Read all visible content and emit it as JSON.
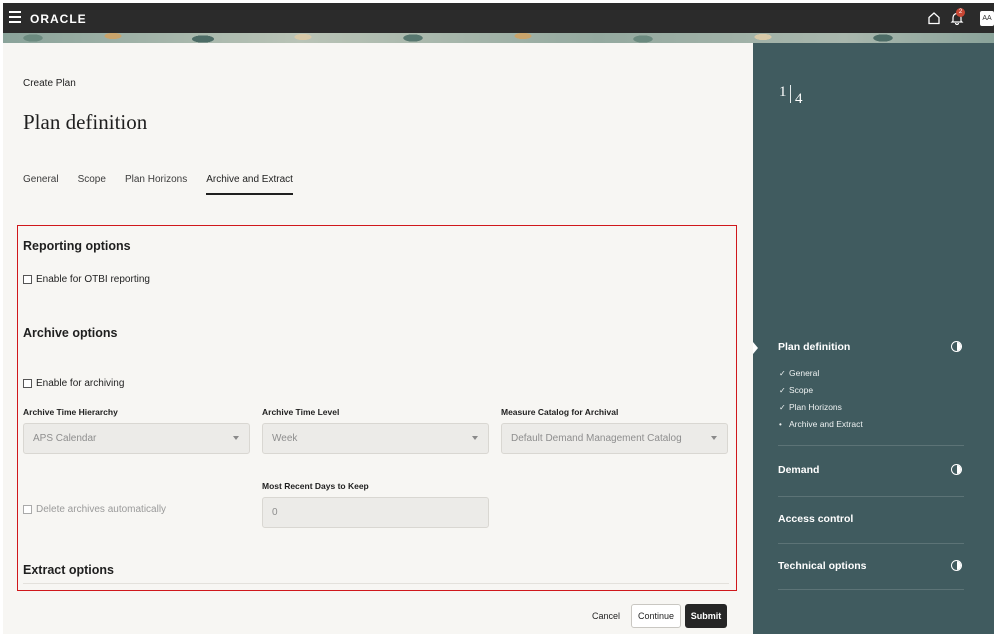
{
  "header": {
    "logo": "ORACLE",
    "notification_count": "2",
    "user_initials": "AA"
  },
  "page": {
    "breadcrumb": "Create Plan",
    "title": "Plan definition",
    "tabs": [
      "General",
      "Scope",
      "Plan Horizons",
      "Archive and Extract"
    ],
    "active_tab": "Archive and Extract"
  },
  "reporting": {
    "title": "Reporting options",
    "otbi_label": "Enable for OTBI reporting"
  },
  "archive": {
    "title": "Archive options",
    "enable_label": "Enable for archiving",
    "time_hierarchy_label": "Archive Time Hierarchy",
    "time_hierarchy_value": "APS Calendar",
    "time_level_label": "Archive Time Level",
    "time_level_value": "Week",
    "catalog_label": "Measure Catalog for Archival",
    "catalog_value": "Default Demand Management Catalog",
    "delete_label": "Delete archives automatically",
    "days_label": "Most Recent Days to Keep",
    "days_value": "0"
  },
  "extract": {
    "title": "Extract options"
  },
  "footer": {
    "cancel": "Cancel",
    "continue": "Continue",
    "submit": "Submit"
  },
  "sidebar": {
    "step_current": "1",
    "step_total": "4",
    "sections": [
      {
        "label": "Plan definition",
        "icon": "half-circle-icon"
      },
      {
        "label": "Demand",
        "icon": "half-circle-icon"
      },
      {
        "label": "Access control"
      },
      {
        "label": "Technical options",
        "icon": "half-circle-icon"
      }
    ],
    "sub_items": [
      {
        "mark": "✓",
        "label": "General"
      },
      {
        "mark": "✓",
        "label": "Scope"
      },
      {
        "mark": "✓",
        "label": "Plan Horizons"
      },
      {
        "mark": "•",
        "label": "Archive and Extract"
      }
    ]
  },
  "colors": {
    "topbar": "#2b2b2b",
    "sidebar": "#405b5f",
    "highlight_box": "#d0181b",
    "submit_button": "#262626"
  }
}
